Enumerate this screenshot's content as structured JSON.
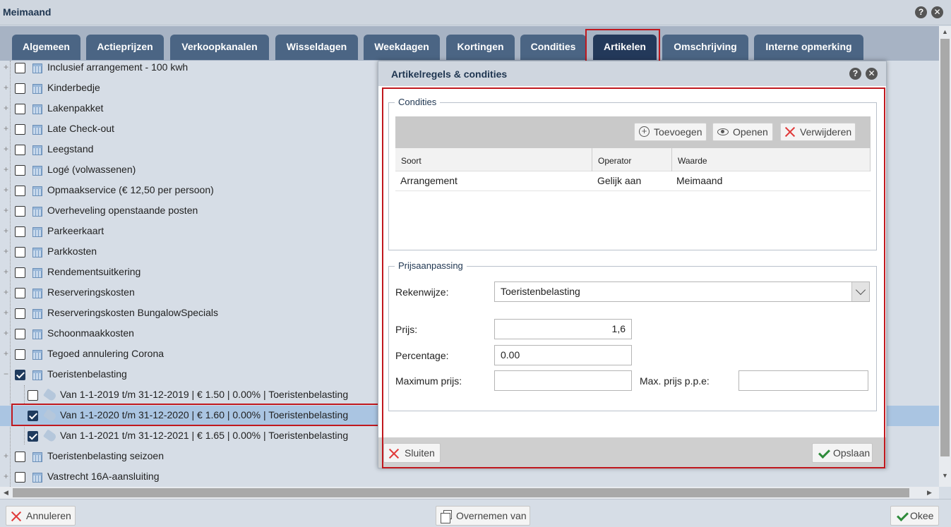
{
  "window": {
    "title": "Meimaand"
  },
  "tabs": [
    {
      "label": "Algemeen"
    },
    {
      "label": "Actieprijzen"
    },
    {
      "label": "Verkoopkanalen"
    },
    {
      "label": "Wisseldagen"
    },
    {
      "label": "Weekdagen"
    },
    {
      "label": "Kortingen"
    },
    {
      "label": "Condities"
    },
    {
      "label": "Artikelen",
      "active": true
    },
    {
      "label": "Omschrijving"
    },
    {
      "label": "Interne opmerking"
    }
  ],
  "tree": {
    "items": [
      {
        "label": "Inclusief arrangement - 100 kwh",
        "checked": false
      },
      {
        "label": "Kinderbedje",
        "checked": false
      },
      {
        "label": "Lakenpakket",
        "checked": false
      },
      {
        "label": "Late Check-out",
        "checked": false
      },
      {
        "label": "Leegstand",
        "checked": false
      },
      {
        "label": "Logé (volwassenen)",
        "checked": false
      },
      {
        "label": "Opmaakservice (€ 12,50 per persoon)",
        "checked": false
      },
      {
        "label": "Overheveling openstaande posten",
        "checked": false
      },
      {
        "label": "Parkeerkaart",
        "checked": false
      },
      {
        "label": "Parkkosten",
        "checked": false
      },
      {
        "label": "Rendementsuitkering",
        "checked": false
      },
      {
        "label": "Reserveringskosten",
        "checked": false
      },
      {
        "label": "Reserveringskosten BungalowSpecials",
        "checked": false
      },
      {
        "label": "Schoonmaakkosten",
        "checked": false
      },
      {
        "label": "Tegoed annulering Corona",
        "checked": false
      },
      {
        "label": "Toeristenbelasting",
        "checked": true
      },
      {
        "label": "Van 1-1-2019 t/m 31-12-2019 | € 1.50 | 0.00% | Toeristenbelasting",
        "checked": false
      },
      {
        "label": "Van 1-1-2020 t/m 31-12-2020 | € 1.60 | 0.00% | Toeristenbelasting",
        "checked": true,
        "selected": true
      },
      {
        "label": "Van 1-1-2021 t/m 31-12-2021 | € 1.65 | 0.00% | Toeristenbelasting",
        "checked": true
      },
      {
        "label": "Toeristenbelasting seizoen",
        "checked": false
      },
      {
        "label": "Vastrecht 16A-aansluiting",
        "checked": false
      }
    ]
  },
  "dialog": {
    "title": "Artikelregels & condities",
    "conditions": {
      "legend": "Condities",
      "toolbar": {
        "add": "Toevoegen",
        "open": "Openen",
        "delete": "Verwijderen"
      },
      "columns": [
        "Soort",
        "Operator",
        "Waarde"
      ],
      "rows": [
        [
          "Arrangement",
          "Gelijk aan",
          "Meimaand"
        ]
      ]
    },
    "price": {
      "legend": "Prijsaanpassing",
      "method_label": "Rekenwijze:",
      "method_value": "Toeristenbelasting",
      "price_label": "Prijs:",
      "price_value": "1,6",
      "percentage_label": "Percentage:",
      "percentage_value": "0.00",
      "max_price_label": "Maximum prijs:",
      "max_price_value": "",
      "max_ppe_label": "Max. prijs p.p.e:",
      "max_ppe_value": ""
    },
    "close_label": "Sluiten",
    "save_label": "Opslaan"
  },
  "footer": {
    "cancel_label": "Annuleren",
    "copy_label": "Overnemen van",
    "ok_label": "Okee"
  },
  "colors": {
    "highlight": "#c0181e",
    "tab": "#4b6584",
    "tab_active": "#23395a"
  }
}
